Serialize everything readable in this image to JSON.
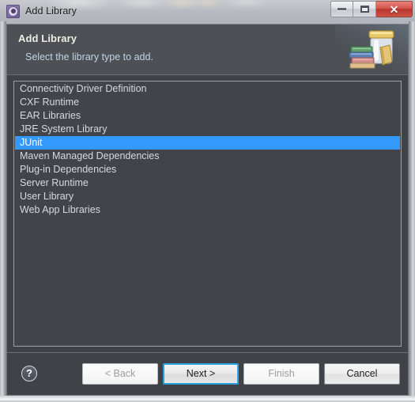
{
  "window": {
    "title": "Add Library",
    "app_icon": "gear-icon",
    "controls": {
      "minimize_label": "Minimize",
      "maximize_label": "Maximize",
      "close_label": "Close",
      "close_glyph": "✕"
    },
    "colors": {
      "selection_blue": "#3399fb",
      "focus_ring": "#2aa3e0",
      "panel_dark": "#3f4347",
      "banner_dark": "#4d5156",
      "list_bg": "#414549",
      "close_red": "#b8352b"
    }
  },
  "banner": {
    "title": "Add Library",
    "description": "Select the library type to add.",
    "icon": "library-jar-books-icon"
  },
  "library_list": {
    "selected_index": 4,
    "items": [
      {
        "label": "Connectivity Driver Definition"
      },
      {
        "label": "CXF Runtime"
      },
      {
        "label": "EAR Libraries"
      },
      {
        "label": "JRE System Library"
      },
      {
        "label": "JUnit"
      },
      {
        "label": "Maven Managed Dependencies"
      },
      {
        "label": "Plug-in Dependencies"
      },
      {
        "label": "Server Runtime"
      },
      {
        "label": "User Library"
      },
      {
        "label": "Web App Libraries"
      }
    ]
  },
  "footer": {
    "help_glyph": "?",
    "buttons": {
      "back": {
        "label": "< Back",
        "enabled": false
      },
      "next": {
        "label": "Next >",
        "enabled": true,
        "default": true
      },
      "finish": {
        "label": "Finish",
        "enabled": false
      },
      "cancel": {
        "label": "Cancel",
        "enabled": true
      }
    }
  }
}
